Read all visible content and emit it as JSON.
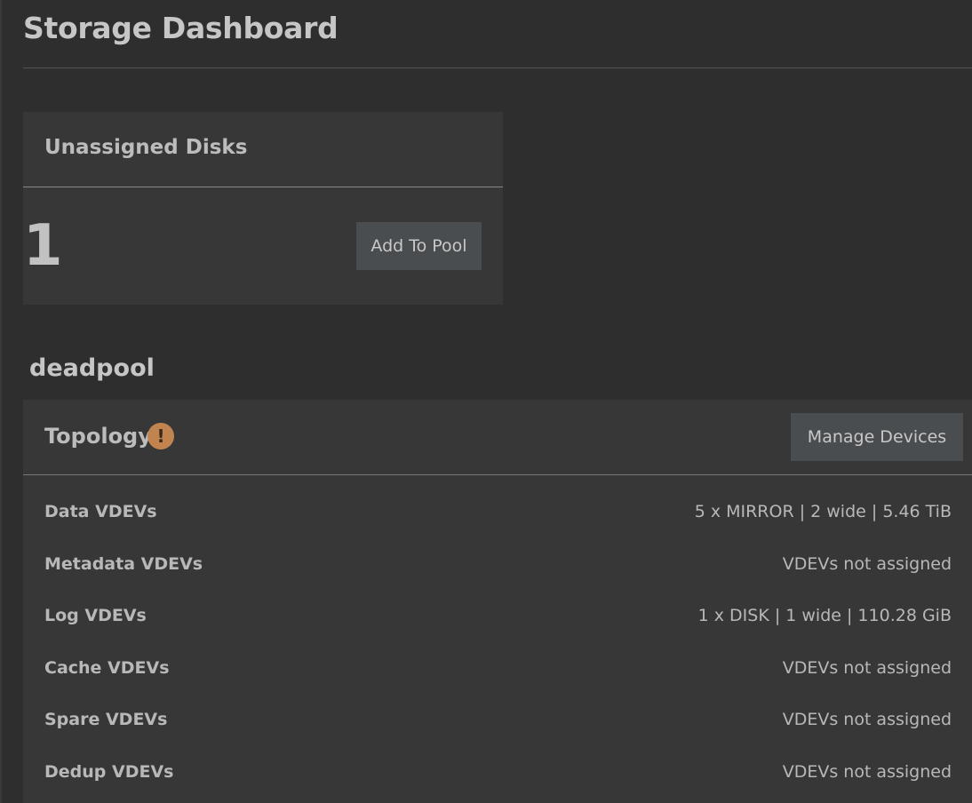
{
  "header": {
    "title": "Storage Dashboard"
  },
  "unassigned": {
    "title": "Unassigned Disks",
    "count": "1",
    "add_button": "Add To Pool"
  },
  "pool": {
    "name": "deadpool",
    "topology": {
      "title": "Topology",
      "warning_icon": "!",
      "manage_button": "Manage Devices",
      "rows": [
        {
          "label": "Data VDEVs",
          "value": "5 x MIRROR | 2 wide | 5.46 TiB"
        },
        {
          "label": "Metadata VDEVs",
          "value": "VDEVs not assigned"
        },
        {
          "label": "Log VDEVs",
          "value": "1 x DISK | 1 wide | 110.28 GiB"
        },
        {
          "label": "Cache VDEVs",
          "value": "VDEVs not assigned"
        },
        {
          "label": "Spare VDEVs",
          "value": "VDEVs not assigned"
        },
        {
          "label": "Dedup VDEVs",
          "value": "VDEVs not assigned"
        }
      ]
    }
  },
  "colors": {
    "background": "#2e2e2e",
    "card": "#373737",
    "button": "#4a4d4f",
    "warning": "#c1844f"
  }
}
